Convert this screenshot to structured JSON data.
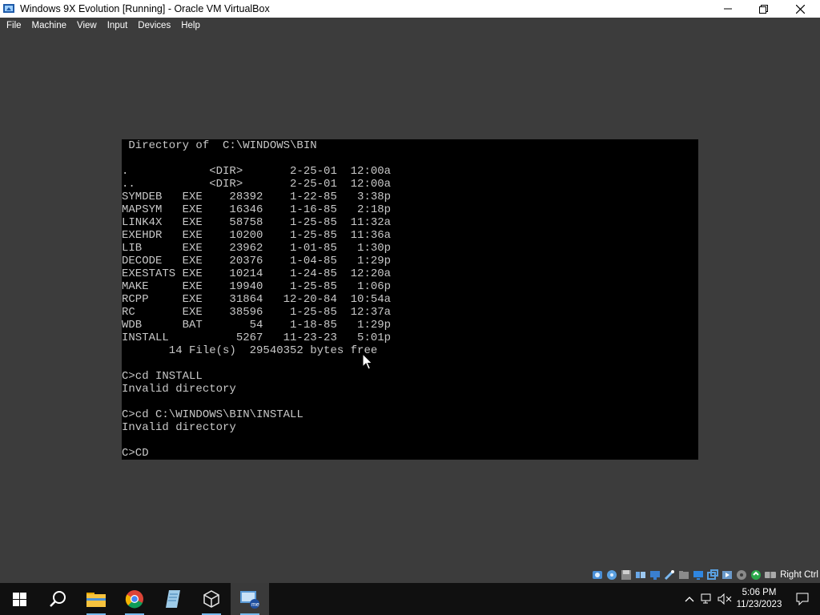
{
  "window": {
    "title": "Windows 9X Evolution [Running] - Oracle VM VirtualBox",
    "minimize_icon": "minimize-icon",
    "restore_icon": "restore-icon",
    "close_icon": "close-icon"
  },
  "menu": [
    "File",
    "Machine",
    "View",
    "Input",
    "Devices",
    "Help"
  ],
  "terminal": {
    "lines": [
      " Directory of  C:\\WINDOWS\\BIN",
      "",
      ".            <DIR>       2-25-01  12:00a",
      "..           <DIR>       2-25-01  12:00a",
      "SYMDEB   EXE    28392    1-22-85   3:38p",
      "MAPSYM   EXE    16346    1-16-85   2:18p",
      "LINK4X   EXE    58758    1-25-85  11:32a",
      "EXEHDR   EXE    10200    1-25-85  11:36a",
      "LIB      EXE    23962    1-01-85   1:30p",
      "DECODE   EXE    20376    1-04-85   1:29p",
      "EXESTATS EXE    10214    1-24-85  12:20a",
      "MAKE     EXE    19940    1-25-85   1:06p",
      "RCPP     EXE    31864   12-20-84  10:54a",
      "RC       EXE    38596    1-25-85  12:37a",
      "WDB      BAT       54    1-18-85   1:29p",
      "INSTALL          5267   11-23-23   5:01p",
      "       14 File(s)  29540352 bytes free",
      "",
      "C>cd INSTALL",
      "Invalid directory",
      "",
      "C>cd C:\\WINDOWS\\BIN\\INSTALL",
      "Invalid directory",
      "",
      "C>CD"
    ]
  },
  "statusbar": {
    "icons": [
      "hard-disk-icon",
      "optical-drive-icon",
      "floppy-icon",
      "audio-icon",
      "network-icon",
      "usb-icon",
      "shared-folder-icon",
      "display-icon",
      "screenshot-icon",
      "recording-icon",
      "cpu-icon",
      "mouse-integration-icon",
      "keyboard-icon"
    ],
    "host_key": "Right Ctrl"
  },
  "taskbar": {
    "apps": [
      {
        "name": "start-icon"
      },
      {
        "name": "search-icon"
      },
      {
        "name": "file-explorer-icon"
      },
      {
        "name": "chrome-icon"
      },
      {
        "name": "notepad-icon"
      },
      {
        "name": "virtualbox-manager-icon"
      },
      {
        "name": "windows-me-vm-icon",
        "active": true
      }
    ],
    "time": "5:06 PM",
    "date": "11/23/2023"
  },
  "colors": {
    "accent": "#76b9ed",
    "vbox_bg": "#3c3c3c",
    "taskbar_bg": "#101010",
    "terminal_fg": "#c8c8c8"
  }
}
